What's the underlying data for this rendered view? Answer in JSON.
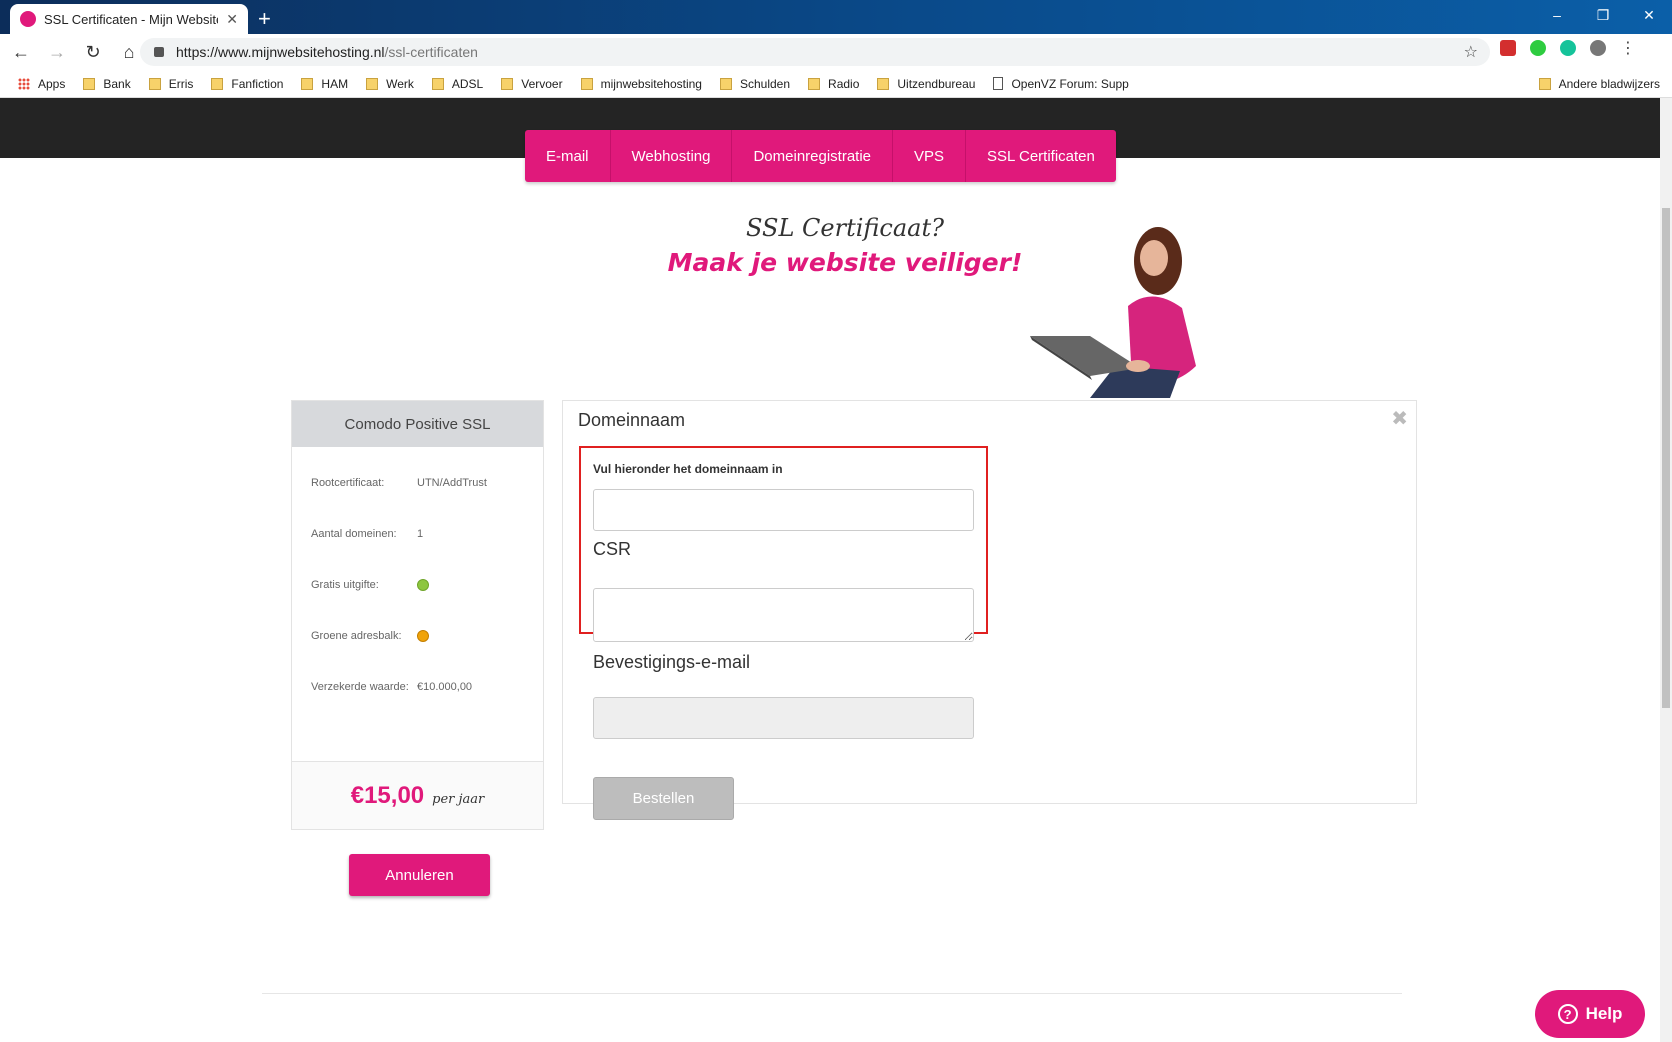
{
  "browser": {
    "tab_title": "SSL Certificaten - Mijn Websiteho",
    "tab_close": "✕",
    "new_tab": "+",
    "window_controls": [
      "–",
      "❐",
      "✕"
    ],
    "url_host": "https://www.mijnwebsitehosting.nl",
    "url_path": "/ssl-certificaten",
    "bookmarks": [
      "Apps",
      "Bank",
      "Erris",
      "Fanfiction",
      "HAM",
      "Werk",
      "ADSL",
      "Vervoer",
      "mijnwebsitehosting",
      "Schulden",
      "Radio",
      "Uitzendbureau",
      "OpenVZ Forum: Supp"
    ],
    "other_bookmarks": "Andere bladwijzers"
  },
  "nav": {
    "items": [
      "E-mail",
      "Webhosting",
      "Domeinregistratie",
      "VPS",
      "SSL Certificaten"
    ]
  },
  "hero": {
    "line1": "SSL Certificaat?",
    "line2": "Maak je website veiliger!"
  },
  "product": {
    "name": "Comodo Positive SSL",
    "specs": [
      {
        "label": "Rootcertificaat:",
        "value": "UTN/AddTrust"
      },
      {
        "label": "Aantal domeinen:",
        "value": "1"
      },
      {
        "label": "Gratis uitgifte:",
        "value": ""
      },
      {
        "label": "Groene adresbalk:",
        "value": ""
      },
      {
        "label": "Verzekerde waarde:",
        "value": "€10.000,00"
      }
    ],
    "price": "€15,00",
    "per": "per jaar",
    "status_colors": {
      "gratis": "#8dc63f",
      "groene": "#f0a30a"
    }
  },
  "actions": {
    "cancel": "Annuleren"
  },
  "form": {
    "title": "Domeinnaam",
    "close": "✖",
    "domain_label": "Vul hieronder het domeinnaam in",
    "domain_value": "",
    "csr_label": "CSR",
    "csr_value": "",
    "email_label": "Bevestigings-e-mail",
    "email_value": "",
    "order_button": "Bestellen"
  },
  "help": {
    "label": "Help",
    "icon": "?"
  },
  "colors": {
    "brand": "#e0197b",
    "highlight": "#e02020"
  }
}
